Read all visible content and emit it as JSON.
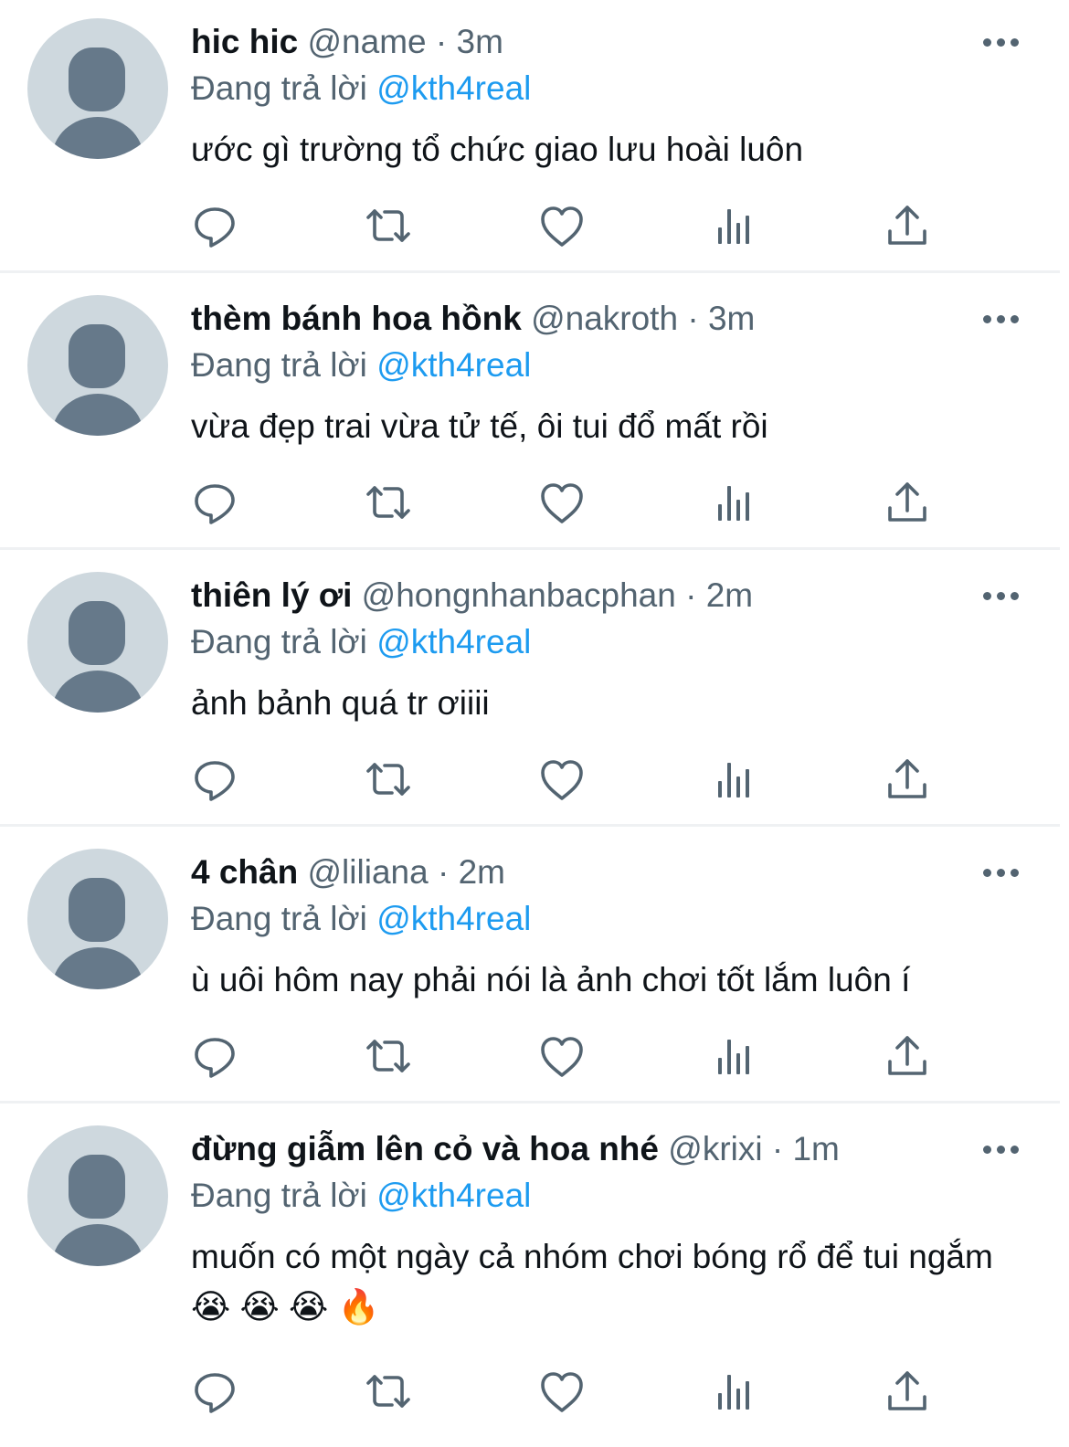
{
  "reply_prefix": "Đang trả lời",
  "colors": {
    "text": "#0f1419",
    "secondary": "#536471",
    "link": "#1d9bf0",
    "avatar_bg": "#ced8de",
    "avatar_fg": "#66798a"
  },
  "actions": [
    {
      "name": "reply-icon"
    },
    {
      "name": "retweet-icon"
    },
    {
      "name": "like-icon"
    },
    {
      "name": "views-icon"
    },
    {
      "name": "share-icon"
    }
  ],
  "tweets": [
    {
      "display_name": "hic hic",
      "handle": "@name",
      "separator": "·",
      "time": "3m",
      "reply_to": "@kth4real",
      "text": "ước gì trường tổ chức giao lưu hoài luôn"
    },
    {
      "display_name": "thèm bánh hoa hồnk",
      "handle": "@nakroth",
      "separator": "·",
      "time": "3m",
      "reply_to": "@kth4real",
      "text": "vừa đẹp trai vừa tử tế, ôi tui đổ mất rồi"
    },
    {
      "display_name": "thiên lý ơi",
      "handle": "@hongnhanbacphan",
      "separator": "·",
      "time": "2m",
      "reply_to": "@kth4real",
      "text": "ảnh bảnh quá tr ơiiii"
    },
    {
      "display_name": "4 chân",
      "handle": "@liliana",
      "separator": "·",
      "time": "2m",
      "reply_to": "@kth4real",
      "text": "ù uôi hôm nay phải nói là ảnh chơi tốt lắm luôn í"
    },
    {
      "display_name": "đừng giẫm lên cỏ và hoa nhé",
      "handle": "@krixi",
      "separator": "·",
      "time": "1m",
      "reply_to": "@kth4real",
      "text": "muốn có một ngày cả nhóm chơi bóng rổ để tui ngắm 😭 😭 😭 🔥"
    }
  ]
}
